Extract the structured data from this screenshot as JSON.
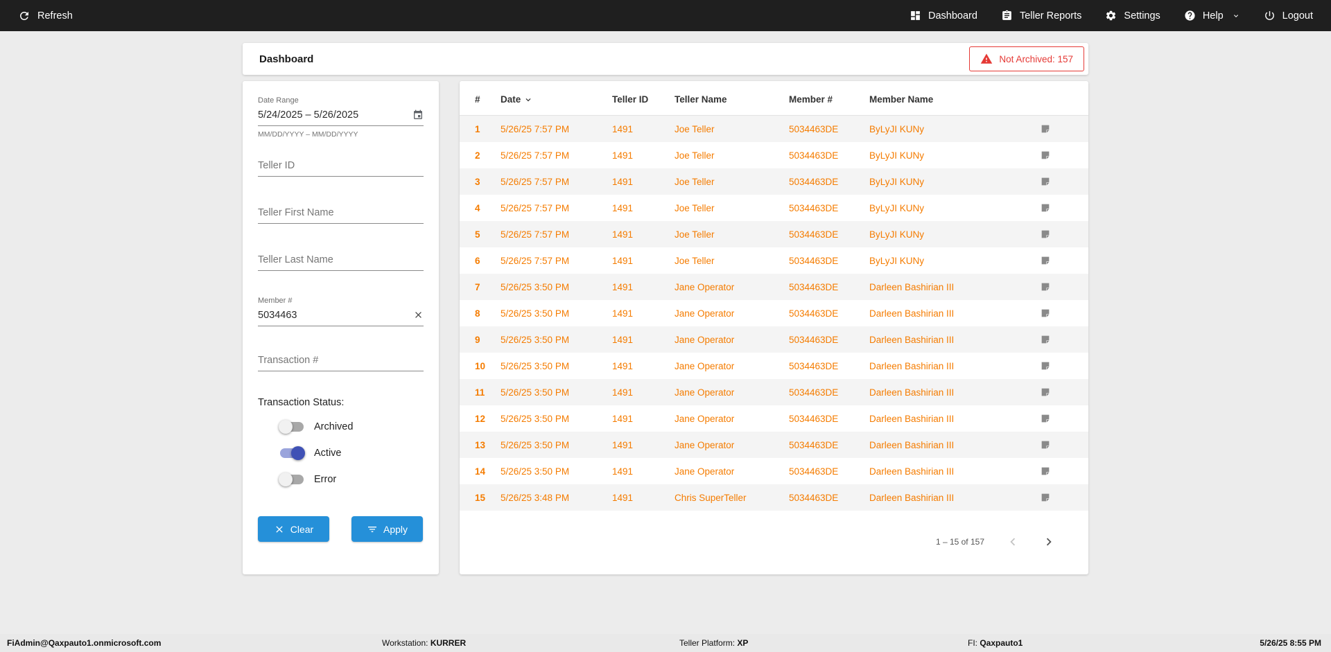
{
  "colors": {
    "accent-orange": "#f57c00",
    "accent-blue": "#2590d9",
    "alert-red": "#e53935",
    "topbar-bg": "#1f1f1f"
  },
  "topbar": {
    "refresh_label": "Refresh",
    "nav": [
      {
        "label": "Dashboard",
        "icon": "dashboard-icon"
      },
      {
        "label": "Teller Reports",
        "icon": "teller-reports-icon"
      },
      {
        "label": "Settings",
        "icon": "settings-icon"
      },
      {
        "label": "Help",
        "icon": "help-icon"
      },
      {
        "label": "Logout",
        "icon": "logout-icon"
      }
    ]
  },
  "header": {
    "title": "Dashboard",
    "badge": "Not Archived: 157"
  },
  "filters": {
    "date_range": {
      "label": "Date Range",
      "value": "5/24/2025 – 5/26/2025",
      "hint": "MM/DD/YYYY – MM/DD/YYYY"
    },
    "teller_id_placeholder": "Teller ID",
    "teller_first_name_placeholder": "Teller First Name",
    "teller_last_name_placeholder": "Teller Last Name",
    "member": {
      "label": "Member #",
      "value": "5034463"
    },
    "transaction_placeholder": "Transaction #",
    "status_label": "Transaction Status:",
    "toggles": [
      {
        "label": "Archived",
        "on": false
      },
      {
        "label": "Active",
        "on": true
      },
      {
        "label": "Error",
        "on": false
      }
    ],
    "clear_label": "Clear",
    "apply_label": "Apply"
  },
  "table": {
    "columns": [
      "#",
      "Date",
      "Teller ID",
      "Teller Name",
      "Member #",
      "Member Name"
    ],
    "rows": [
      {
        "num": "1",
        "date": "5/26/25 7:57 PM",
        "teller_id": "1491",
        "teller_name": "Joe Teller",
        "member": "5034463DE",
        "member_name": "ByLyJI KUNy"
      },
      {
        "num": "2",
        "date": "5/26/25 7:57 PM",
        "teller_id": "1491",
        "teller_name": "Joe Teller",
        "member": "5034463DE",
        "member_name": "ByLyJI KUNy"
      },
      {
        "num": "3",
        "date": "5/26/25 7:57 PM",
        "teller_id": "1491",
        "teller_name": "Joe Teller",
        "member": "5034463DE",
        "member_name": "ByLyJI KUNy"
      },
      {
        "num": "4",
        "date": "5/26/25 7:57 PM",
        "teller_id": "1491",
        "teller_name": "Joe Teller",
        "member": "5034463DE",
        "member_name": "ByLyJI KUNy"
      },
      {
        "num": "5",
        "date": "5/26/25 7:57 PM",
        "teller_id": "1491",
        "teller_name": "Joe Teller",
        "member": "5034463DE",
        "member_name": "ByLyJI KUNy"
      },
      {
        "num": "6",
        "date": "5/26/25 7:57 PM",
        "teller_id": "1491",
        "teller_name": "Joe Teller",
        "member": "5034463DE",
        "member_name": "ByLyJI KUNy"
      },
      {
        "num": "7",
        "date": "5/26/25 3:50 PM",
        "teller_id": "1491",
        "teller_name": "Jane Operator",
        "member": "5034463DE",
        "member_name": "Darleen Bashirian III"
      },
      {
        "num": "8",
        "date": "5/26/25 3:50 PM",
        "teller_id": "1491",
        "teller_name": "Jane Operator",
        "member": "5034463DE",
        "member_name": "Darleen Bashirian III"
      },
      {
        "num": "9",
        "date": "5/26/25 3:50 PM",
        "teller_id": "1491",
        "teller_name": "Jane Operator",
        "member": "5034463DE",
        "member_name": "Darleen Bashirian III"
      },
      {
        "num": "10",
        "date": "5/26/25 3:50 PM",
        "teller_id": "1491",
        "teller_name": "Jane Operator",
        "member": "5034463DE",
        "member_name": "Darleen Bashirian III"
      },
      {
        "num": "11",
        "date": "5/26/25 3:50 PM",
        "teller_id": "1491",
        "teller_name": "Jane Operator",
        "member": "5034463DE",
        "member_name": "Darleen Bashirian III"
      },
      {
        "num": "12",
        "date": "5/26/25 3:50 PM",
        "teller_id": "1491",
        "teller_name": "Jane Operator",
        "member": "5034463DE",
        "member_name": "Darleen Bashirian III"
      },
      {
        "num": "13",
        "date": "5/26/25 3:50 PM",
        "teller_id": "1491",
        "teller_name": "Jane Operator",
        "member": "5034463DE",
        "member_name": "Darleen Bashirian III"
      },
      {
        "num": "14",
        "date": "5/26/25 3:50 PM",
        "teller_id": "1491",
        "teller_name": "Jane Operator",
        "member": "5034463DE",
        "member_name": "Darleen Bashirian III"
      },
      {
        "num": "15",
        "date": "5/26/25 3:48 PM",
        "teller_id": "1491",
        "teller_name": "Chris SuperTeller",
        "member": "5034463DE",
        "member_name": "Darleen Bashirian III"
      }
    ],
    "row_note_icon": "note-icon",
    "pagination": {
      "range_label": "1 – 15 of 157"
    }
  },
  "statusbar": {
    "user": "FiAdmin@Qaxpauto1.onmicrosoft.com",
    "workstation_label": "Workstation: ",
    "workstation_value": "KURRER",
    "platform_label": "Teller Platform: ",
    "platform_value": "XP",
    "fi_label": "FI: ",
    "fi_value": "Qaxpauto1",
    "datetime": "5/26/25 8:55 PM"
  }
}
